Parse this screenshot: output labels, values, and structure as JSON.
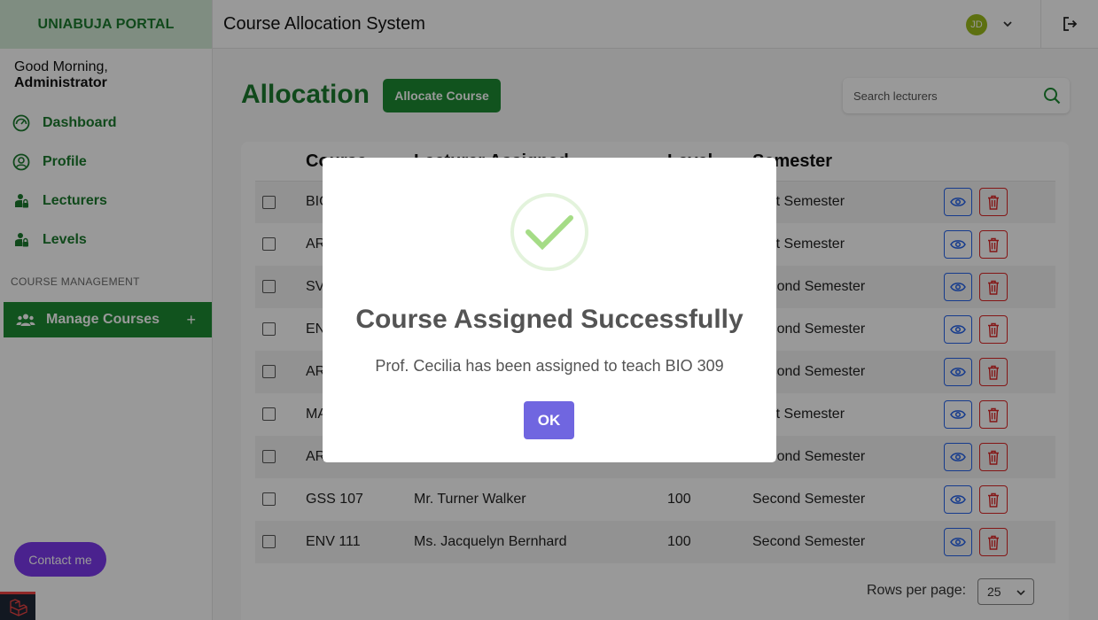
{
  "brand": "UNIABUJA PORTAL",
  "greeting": {
    "prefix": "Good Morning, ",
    "name": "Administrator"
  },
  "nav": [
    {
      "label": "Dashboard",
      "icon": "dashboard-icon"
    },
    {
      "label": "Profile",
      "icon": "user-circle-icon"
    },
    {
      "label": "Lecturers",
      "icon": "lock-user-icon"
    },
    {
      "label": "Levels",
      "icon": "lock-user-icon"
    }
  ],
  "section_label": "COURSE MANAGEMENT",
  "manage_courses": {
    "label": "Manage Courses",
    "action": "+"
  },
  "contact_label": "Contact me",
  "header": {
    "title": "Course Allocation System",
    "avatar_initials": "JD"
  },
  "main": {
    "title": "Allocation",
    "allocate_label": "Allocate Course",
    "search_placeholder": "Search lecturers"
  },
  "table": {
    "columns": [
      "Course",
      "Lecturer Assigned",
      "Level",
      "Semester"
    ],
    "rows": [
      {
        "course": "BIO",
        "lecturer": "",
        "level": "",
        "semester": "First Semester"
      },
      {
        "course": "AR",
        "lecturer": "",
        "level": "",
        "semester": "First Semester"
      },
      {
        "course": "SV",
        "lecturer": "",
        "level": "",
        "semester": "Second Semester"
      },
      {
        "course": "EN",
        "lecturer": "",
        "level": "",
        "semester": "Second Semester"
      },
      {
        "course": "AR",
        "lecturer": "",
        "level": "",
        "semester": "Second Semester"
      },
      {
        "course": "MA",
        "lecturer": "",
        "level": "",
        "semester": "First Semester"
      },
      {
        "course": "AR",
        "lecturer": "",
        "level": "",
        "semester": "Second Semester"
      },
      {
        "course": "GSS 107",
        "lecturer": "Mr. Turner Walker",
        "level": "100",
        "semester": "Second Semester"
      },
      {
        "course": "ENV 111",
        "lecturer": "Ms. Jacquelyn Bernhard",
        "level": "100",
        "semester": "Second Semester"
      }
    ]
  },
  "pagination": {
    "rows_per_page_label": "Rows per page:",
    "rows_per_page_value": "25"
  },
  "modal": {
    "title": "Course Assigned Successfully",
    "text": "Prof. Cecilia has been assigned to teach BIO 309",
    "ok_label": "OK"
  },
  "colors": {
    "brand_green": "#1d8a33",
    "modal_button": "#7066e0",
    "contact_button": "#7c3aed"
  }
}
